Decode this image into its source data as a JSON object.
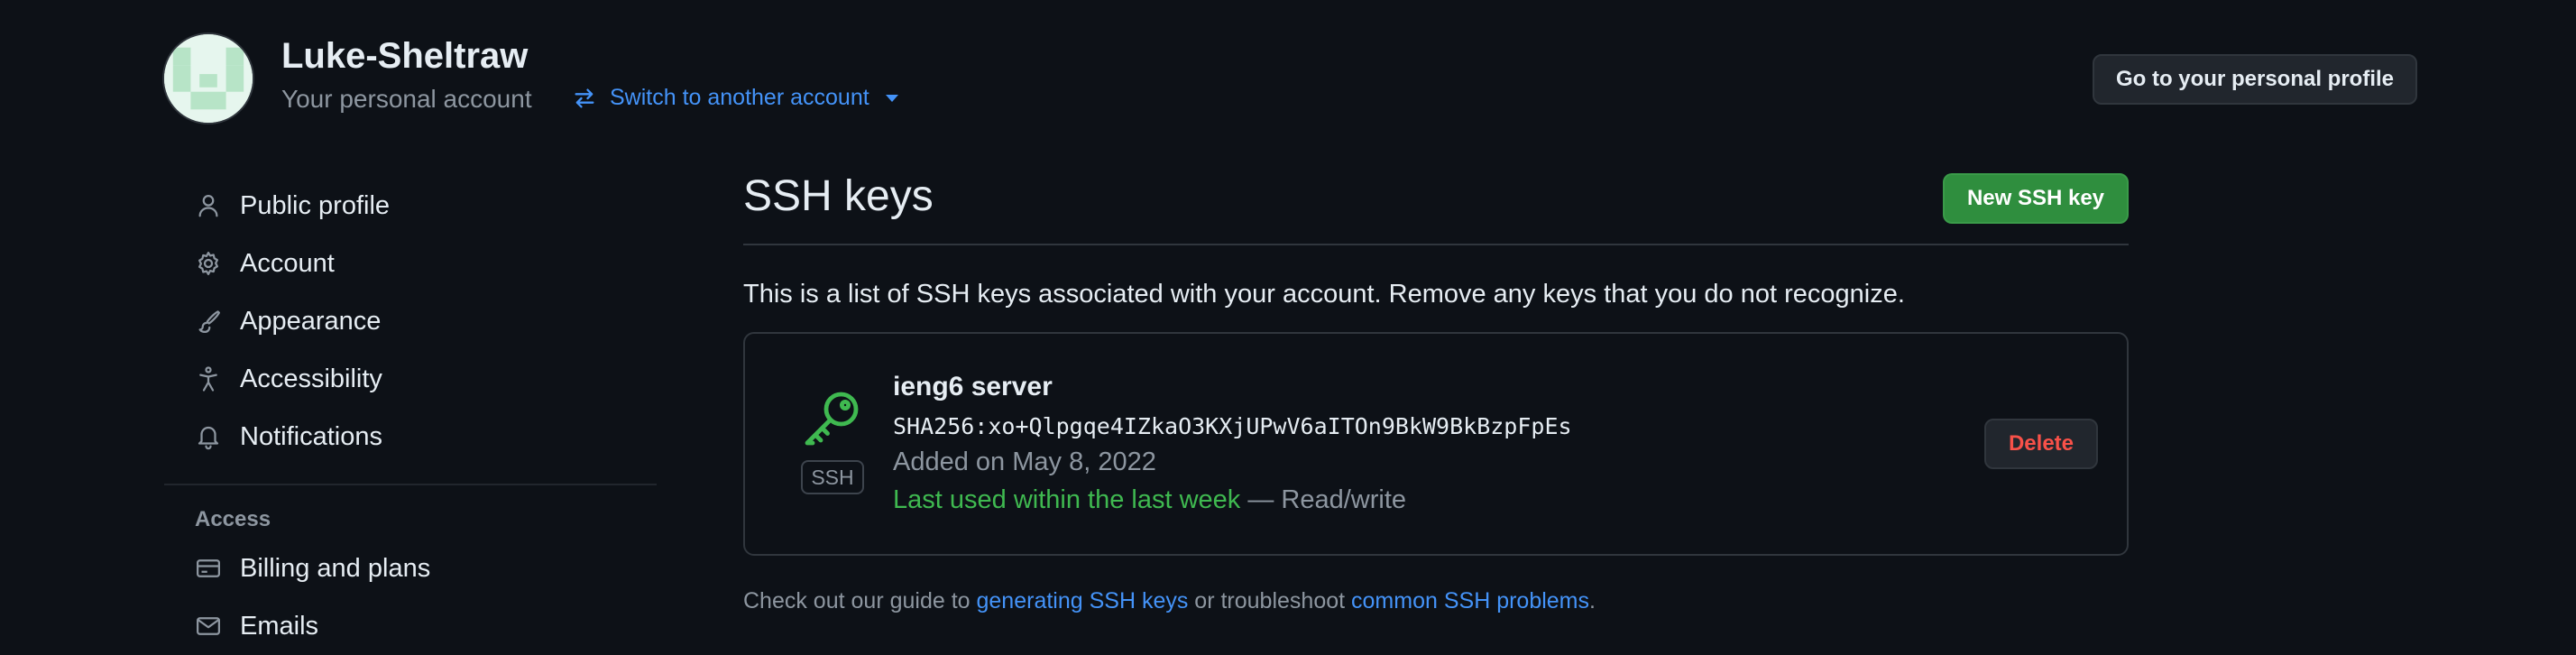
{
  "header": {
    "username": "Luke-Sheltraw",
    "account_type": "Your personal account",
    "switch_label": "Switch to another account",
    "profile_button": "Go to your personal profile"
  },
  "sidebar": {
    "items": [
      {
        "label": "Public profile",
        "icon": "person-icon"
      },
      {
        "label": "Account",
        "icon": "gear-icon"
      },
      {
        "label": "Appearance",
        "icon": "paintbrush-icon"
      },
      {
        "label": "Accessibility",
        "icon": "accessibility-icon"
      },
      {
        "label": "Notifications",
        "icon": "bell-icon"
      }
    ],
    "section_access": "Access",
    "access_items": [
      {
        "label": "Billing and plans",
        "icon": "credit-card-icon"
      },
      {
        "label": "Emails",
        "icon": "mail-icon"
      }
    ]
  },
  "main": {
    "title": "SSH keys",
    "new_button": "New SSH key",
    "description": "This is a list of SSH keys associated with your account. Remove any keys that you do not recognize.",
    "keys": [
      {
        "badge": "SSH",
        "name": "ieng6 server",
        "fingerprint": "SHA256:xo+Qlpgqe4IZkaO3KXjUPwV6aITOn9BkW9BkBzpFpEs",
        "added": "Added on May 8, 2022",
        "last_used": "Last used within the last week",
        "access": "— Read/write",
        "delete_label": "Delete"
      }
    ],
    "footer": {
      "prefix": "Check out our guide to ",
      "link1": "generating SSH keys",
      "middle": " or troubleshoot ",
      "link2": "common SSH problems",
      "suffix": "."
    }
  },
  "colors": {
    "background": "#0d1117",
    "accent": "#4493f8",
    "primary_button": "#2f8e3e",
    "success_text": "#3fb950",
    "danger_text": "#f85149"
  }
}
